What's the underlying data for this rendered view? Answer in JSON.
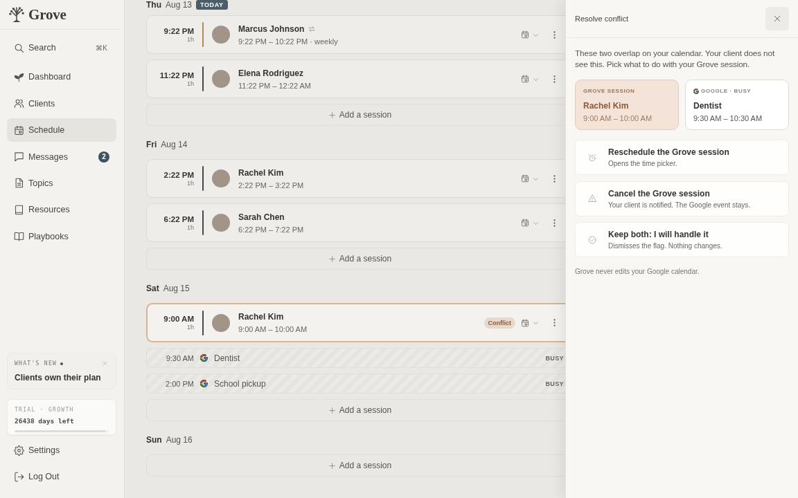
{
  "sidebar": {
    "brand": "Grove",
    "search": {
      "label": "Search",
      "shortcut": "⌘K"
    },
    "nav": [
      {
        "label": "Dashboard",
        "selected": false
      },
      {
        "label": "Clients",
        "selected": false
      },
      {
        "label": "Schedule",
        "selected": true
      },
      {
        "label": "Messages",
        "selected": false,
        "badge": "2"
      },
      {
        "label": "Topics",
        "selected": false
      },
      {
        "label": "Resources",
        "selected": false
      },
      {
        "label": "Playbooks",
        "selected": false
      }
    ],
    "whats_new": {
      "eyebrow": "WHAT'S NEW",
      "unread": true,
      "title": "Clients own their plan"
    },
    "trial": {
      "eyebrow": "TRIAL · GROWTH",
      "days_left": "26438 days left",
      "level": 0.96
    },
    "footer": [
      {
        "label": "Settings"
      },
      {
        "label": "Log Out"
      }
    ]
  },
  "schedule": {
    "days": [
      {
        "weekday": "Thu",
        "date": "Aug 13",
        "badge": "TODAY",
        "items": [
          {
            "kind": "session",
            "time": "9:22 PM",
            "duration": "1h",
            "name": "Marcus Johnson",
            "range": "9:22 PM – 10:22 PM · weekly",
            "recurring": true,
            "flagged": false,
            "color": "#b08a58"
          },
          {
            "kind": "session",
            "time": "11:22 PM",
            "duration": "1h",
            "name": "Elena Rodriguez",
            "range": "11:22 PM – 12:22 AM",
            "recurring": false,
            "flagged": false,
            "color": "#3e4c54"
          },
          {
            "kind": "add",
            "label": "Add a session"
          }
        ]
      },
      {
        "weekday": "Fri",
        "date": "Aug 14",
        "items": [
          {
            "kind": "session",
            "time": "2:22 PM",
            "duration": "1h",
            "name": "Rachel Kim",
            "range": "2:22 PM – 3:22 PM",
            "recurring": false,
            "flagged": false,
            "color": "#3e4c54"
          },
          {
            "kind": "session",
            "time": "6:22 PM",
            "duration": "1h",
            "name": "Sarah Chen",
            "range": "6:22 PM – 7:22 PM",
            "recurring": false,
            "flagged": false,
            "color": "#3e4c54"
          },
          {
            "kind": "add",
            "label": "Add a session"
          }
        ]
      },
      {
        "weekday": "Sat",
        "date": "Aug 15",
        "items": [
          {
            "kind": "session",
            "time": "9:00 AM",
            "duration": "1h",
            "name": "Rachel Kim",
            "range": "9:00 AM – 10:00 AM",
            "recurring": false,
            "flagged": true,
            "badge": "Conflict",
            "color": "#3e4c54"
          },
          {
            "kind": "external",
            "time": "9:30 AM",
            "title": "Dentist",
            "status": "BUSY"
          },
          {
            "kind": "external",
            "time": "2:00 PM",
            "title": "School pickup",
            "status": "BUSY"
          },
          {
            "kind": "add",
            "label": "Add a session"
          }
        ]
      },
      {
        "weekday": "Sun",
        "date": "Aug 16",
        "items": [
          {
            "kind": "add",
            "label": "Add a session"
          }
        ]
      }
    ]
  },
  "conflict_panel": {
    "title": "Resolve conflict",
    "description": "These two overlap on your calendar. Your client does not see this. Pick what to do with your Grove session.",
    "events": [
      {
        "kind": "grove",
        "eyebrow": "GROVE SESSION",
        "title": "Rachel Kim",
        "time": "9:00 AM – 10:00 AM"
      },
      {
        "kind": "google",
        "eyebrow": "GOOGLE · BUSY",
        "title": "Dentist",
        "time": "9:30 AM – 10:30 AM"
      }
    ],
    "options": [
      {
        "title": "Reschedule the Grove session",
        "subtitle": "Opens the time picker."
      },
      {
        "title": "Cancel the Grove session",
        "subtitle": "Your client is notified. The Google event stays."
      },
      {
        "title": "Keep both: I will handle it",
        "subtitle": "Dismisses the flag. Nothing changes."
      }
    ],
    "note": "Grove never edits your Google calendar."
  }
}
